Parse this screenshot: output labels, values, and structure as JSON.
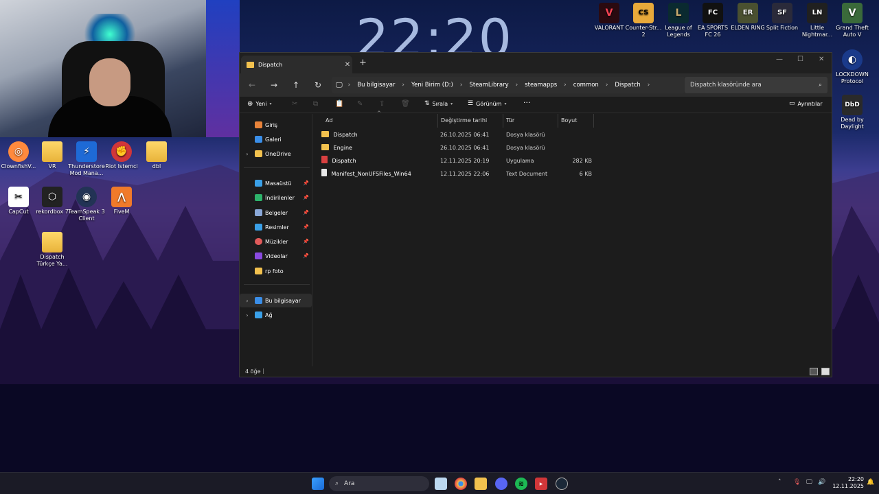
{
  "desktop": {
    "clock": "22:20",
    "left_icons": [
      {
        "label": "ClownfishV...",
        "color": "#ff8a3d",
        "glyph": "◎"
      },
      {
        "label": "VR",
        "color": "#f2c14e",
        "glyph": ""
      },
      {
        "label": "Thunderstore Mod Mana...",
        "color": "#1e6ad6",
        "glyph": "⚡"
      },
      {
        "label": "Riot Istemci",
        "color": "#d13639",
        "glyph": "✊"
      },
      {
        "label": "dbl",
        "color": "#f2c14e",
        "glyph": ""
      },
      {
        "label": "CapCut",
        "color": "#111111",
        "glyph": "✂"
      },
      {
        "label": "rekordbox 7",
        "color": "#222222",
        "glyph": "⬡"
      },
      {
        "label": "TeamSpeak 3 Client",
        "color": "#223355",
        "glyph": "🎧"
      },
      {
        "label": "FiveM",
        "color": "#f07a2a",
        "glyph": "⋀"
      },
      {
        "label": "Dispatch Türkçe Ya...",
        "color": "#f2c14e",
        "glyph": ""
      }
    ],
    "right_icons": [
      {
        "label": "VALORANT",
        "color": "#fa4454",
        "glyph": "V"
      },
      {
        "label": "Counter-Str... 2",
        "color": "#e8a93a",
        "glyph": "CS"
      },
      {
        "label": "League of Legends",
        "color": "#c8aa6e",
        "glyph": "L"
      },
      {
        "label": "EA SPORTS FC 26",
        "color": "#111111",
        "glyph": "FC"
      },
      {
        "label": "ELDEN RING",
        "color": "#4a5030",
        "glyph": "ER"
      },
      {
        "label": "Split Fiction",
        "color": "#2a2a3a",
        "glyph": "SF"
      },
      {
        "label": "Little Nightmar...",
        "color": "#202020",
        "glyph": "LN"
      },
      {
        "label": "Grand Theft Auto V",
        "color": "#3a6a3a",
        "glyph": "V"
      },
      {
        "label": "LOCKDOWN Protocol",
        "color": "#1a3a8a",
        "glyph": "◐"
      },
      {
        "label": "Dead by Daylight",
        "color": "#2a2a2a",
        "glyph": "DbD"
      }
    ]
  },
  "window": {
    "tab_title": "Dispatch",
    "new_tab": "+",
    "controls": {
      "minimize": "—",
      "maximize": "☐",
      "close": "✕"
    },
    "breadcrumb": [
      "Bu bilgisayar",
      "Yeni Birim (D:)",
      "SteamLibrary",
      "steamapps",
      "common",
      "Dispatch"
    ],
    "search_placeholder": "Dispatch klasöründe ara",
    "toolbar": {
      "new": "Yeni",
      "sort": "Sırala",
      "view": "Görünüm",
      "more": "···",
      "details": "Ayrıntılar"
    },
    "nav": [
      {
        "label": "Giriş",
        "icon_color": "#e8833a",
        "pinned": false,
        "chev": false
      },
      {
        "label": "Galeri",
        "icon_color": "#3a8ee8",
        "pinned": false,
        "chev": false
      },
      {
        "label": "OneDrive",
        "icon_color": "#f2c14e",
        "pinned": false,
        "chev": true
      },
      {
        "label": "Masaüstü",
        "icon_color": "#3aa0e8",
        "pinned": true,
        "chev": false
      },
      {
        "label": "İndirilenler",
        "icon_color": "#2db36b",
        "pinned": true,
        "chev": false
      },
      {
        "label": "Belgeler",
        "icon_color": "#8aa8d8",
        "pinned": true,
        "chev": false
      },
      {
        "label": "Resimler",
        "icon_color": "#3aa0e8",
        "pinned": true,
        "chev": false
      },
      {
        "label": "Müzikler",
        "icon_color": "#e05a5a",
        "pinned": true,
        "chev": false
      },
      {
        "label": "Videolar",
        "icon_color": "#8a4ae0",
        "pinned": true,
        "chev": false
      },
      {
        "label": "rp foto",
        "icon_color": "#f2c14e",
        "pinned": false,
        "chev": false
      },
      {
        "label": "Bu bilgisayar",
        "icon_color": "#3a8ee8",
        "pinned": false,
        "chev": true
      },
      {
        "label": "Ağ",
        "icon_color": "#3aa0e8",
        "pinned": false,
        "chev": true
      }
    ],
    "columns": [
      "Ad",
      "Değiştirme tarihi",
      "Tür",
      "Boyut"
    ],
    "files": [
      {
        "name": "Dispatch",
        "date": "26.10.2025 06:41",
        "type": "Dosya klasörü",
        "size": "",
        "kind": "folder"
      },
      {
        "name": "Engine",
        "date": "26.10.2025 06:41",
        "type": "Dosya klasörü",
        "size": "",
        "kind": "folder"
      },
      {
        "name": "Dispatch",
        "date": "12.11.2025 20:19",
        "type": "Uygulama",
        "size": "282 KB",
        "kind": "app"
      },
      {
        "name": "Manifest_NonUFSFiles_Win64",
        "date": "12.11.2025 22:06",
        "type": "Text Document",
        "size": "6 KB",
        "kind": "text"
      }
    ],
    "status": "4 öğe"
  },
  "taskbar": {
    "search_label": "Ara",
    "time": "22:20",
    "date": "12.11.2025"
  }
}
